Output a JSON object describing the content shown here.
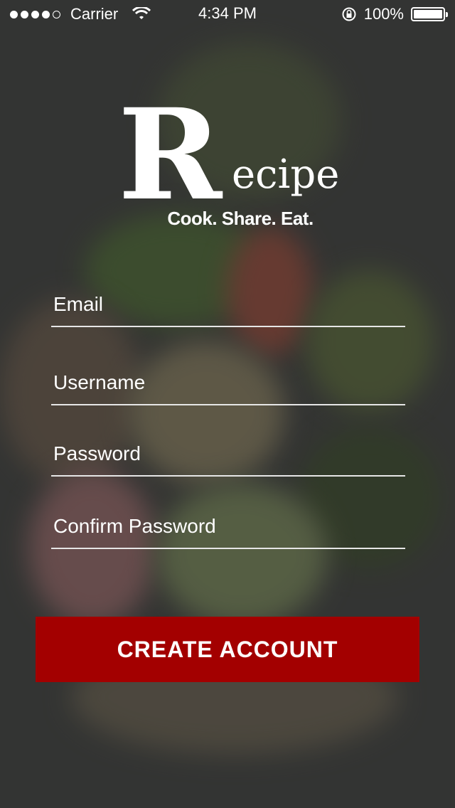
{
  "status_bar": {
    "carrier": "Carrier",
    "time": "4:34 PM",
    "battery": "100%"
  },
  "logo": {
    "initial": "R",
    "rest": "ecipe",
    "tagline": "Cook. Share. Eat."
  },
  "form": {
    "email_placeholder": "Email",
    "username_placeholder": "Username",
    "password_placeholder": "Password",
    "confirm_password_placeholder": "Confirm Password"
  },
  "actions": {
    "create_account_label": "CREATE ACCOUNT"
  },
  "colors": {
    "button": "#a30000",
    "text": "#ffffff"
  }
}
